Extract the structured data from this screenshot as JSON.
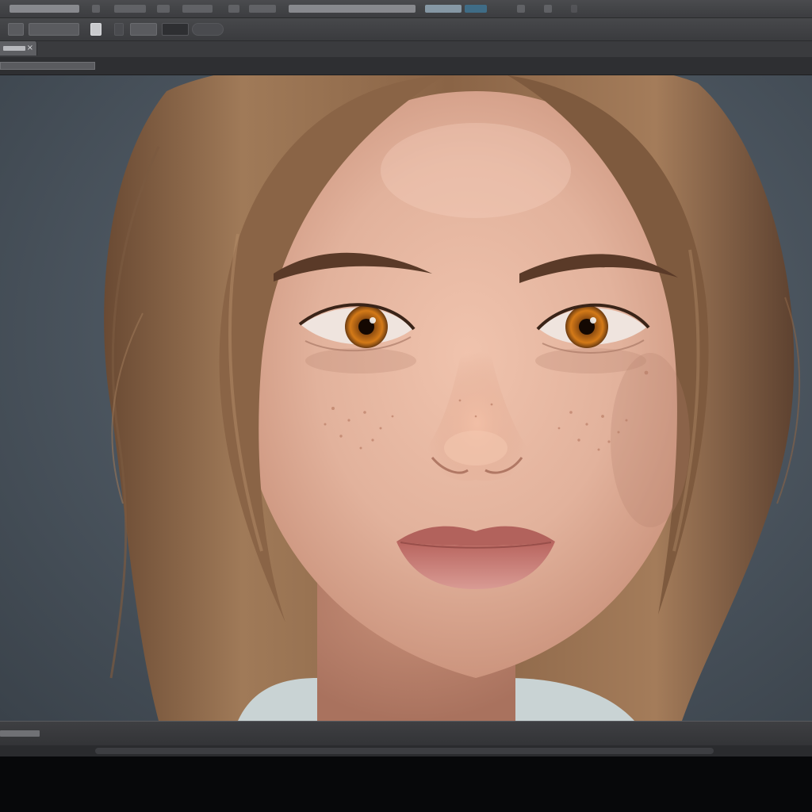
{
  "app": {
    "theme_colors": {
      "chrome_dark": "#3a3b3e",
      "chrome_mid": "#47484b",
      "canvas_bg": "#4c5660",
      "bezel": "#07080a"
    }
  },
  "menubar": {
    "items": [
      "menu-1",
      "menu-2",
      "menu-3",
      "menu-4",
      "menu-5",
      "menu-6",
      "menu-7",
      "menu-8",
      "menu-9",
      "menu-10",
      "menu-11"
    ]
  },
  "optionsbar": {
    "tools": [
      "tool-preset",
      "brush-size",
      "mode",
      "opacity",
      "flow",
      "airbrush",
      "pressure"
    ]
  },
  "document": {
    "tab_close": "×"
  },
  "canvas": {
    "image": "portrait-render",
    "colors": {
      "hair": "#8a6446",
      "skin": "#e2b29c",
      "iris": "#c2701a",
      "lips": "#c77d78"
    }
  },
  "statusbar": {
    "scroll": "horizontal-scrollbar"
  }
}
